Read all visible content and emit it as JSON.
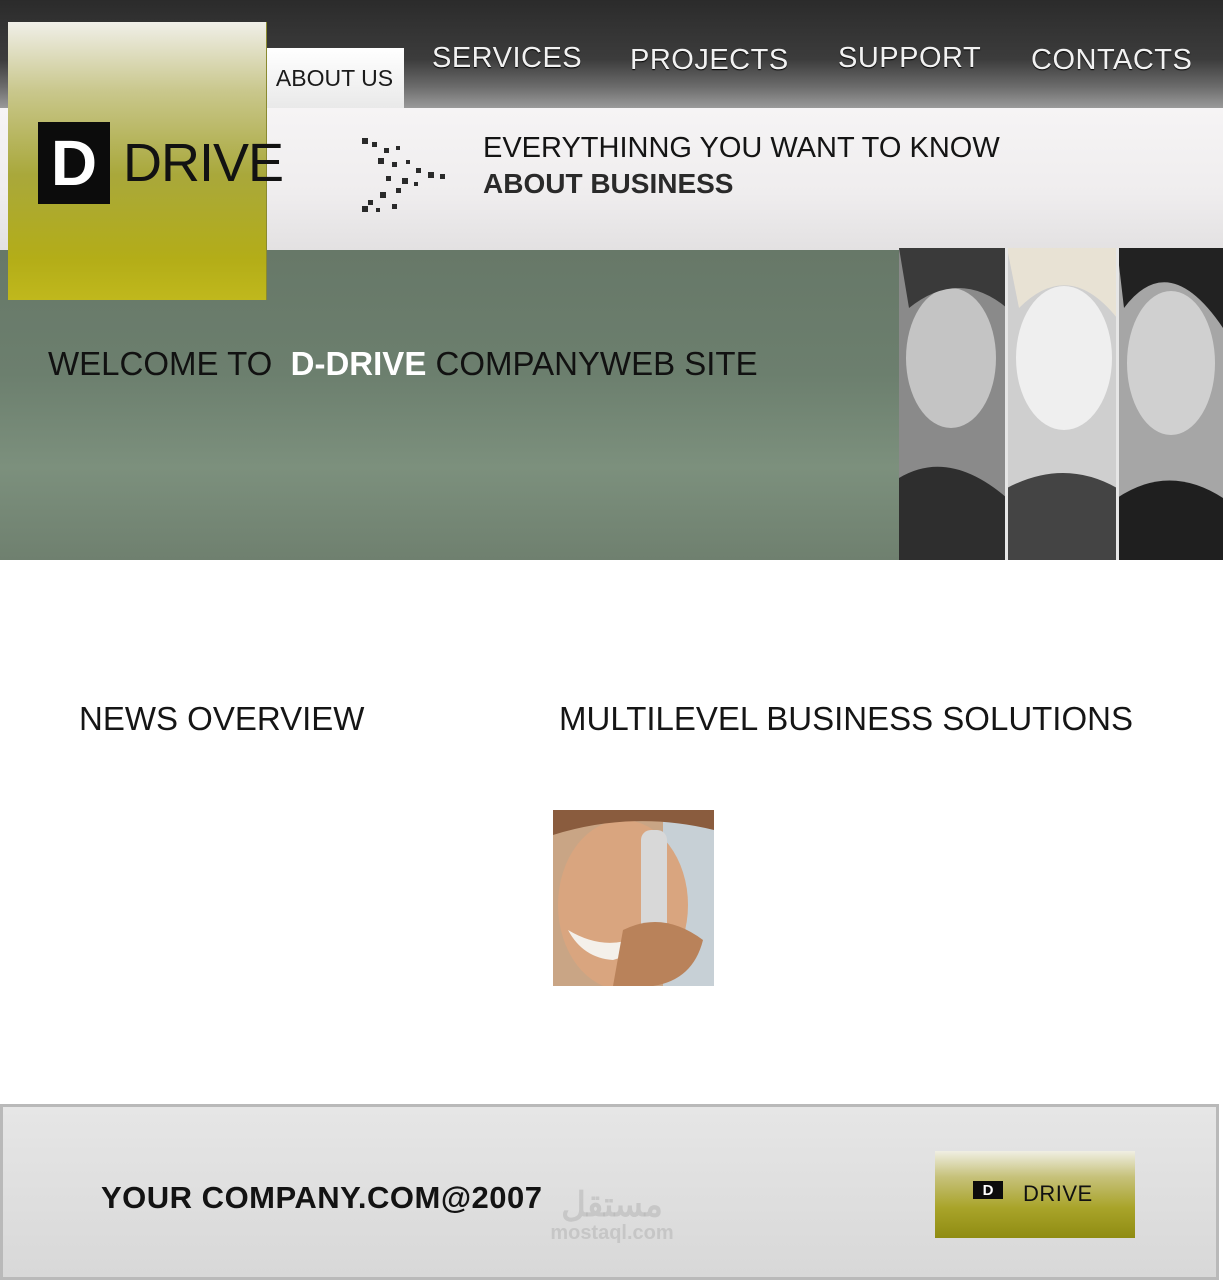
{
  "brand": {
    "logo_letter": "D",
    "logo_word": "DRIVE"
  },
  "nav": {
    "active_tab": "ABOUT US",
    "items": [
      "SERVICES",
      "PROJECTS",
      "SUPPORT",
      "CONTACTS"
    ]
  },
  "tagline": {
    "line1": "EVERYTHINNG YOU WANT TO KNOW",
    "line2": "ABOUT BUSINESS"
  },
  "welcome": {
    "prefix": "WELCOME TO  ",
    "brand": "D-DRIVE",
    "suffix": " COMPANYWEB SITE"
  },
  "sections": {
    "news_title": "NEWS OVERVIEW",
    "solutions_title": "MULTILEVEL BUSINESS SOLUTIONS"
  },
  "footer": {
    "copyright": "YOUR COMPANY.COM@2007",
    "logo_letter": "D",
    "logo_word": "DRIVE"
  },
  "watermark": {
    "arabic": "مستقل",
    "latin": "mostaql.com"
  },
  "colors": {
    "logo_gold": "#b3ad18",
    "welcome_band": "#6c7f6e",
    "topbar": "#2b2b2b"
  }
}
